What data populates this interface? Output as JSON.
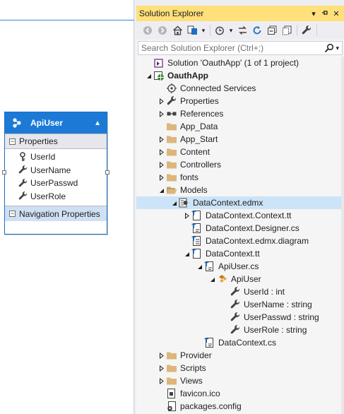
{
  "designer": {
    "entity": {
      "name": "ApiUser",
      "properties_header": "Properties",
      "properties": [
        "UserId",
        "UserName",
        "UserPasswd",
        "UserRole"
      ],
      "navigation_header": "Navigation Properties"
    }
  },
  "solution_explorer": {
    "title": "Solution Explorer",
    "search_placeholder": "Search Solution Explorer (Ctrl+;)",
    "tree": [
      {
        "label": "Solution 'OauthApp' (1 of 1 project)",
        "icon": "solution-icon",
        "level": 0,
        "expander": "none"
      },
      {
        "label": "OauthApp",
        "icon": "web-project-icon",
        "level": 0,
        "expander": "expanded",
        "bold": true
      },
      {
        "label": "Connected Services",
        "icon": "connected-services-icon",
        "level": 1,
        "expander": "none"
      },
      {
        "label": "Properties",
        "icon": "wrench-icon",
        "level": 1,
        "expander": "collapsed"
      },
      {
        "label": "References",
        "icon": "references-icon",
        "level": 1,
        "expander": "collapsed"
      },
      {
        "label": "App_Data",
        "icon": "folder-icon",
        "level": 1,
        "expander": "none"
      },
      {
        "label": "App_Start",
        "icon": "folder-icon",
        "level": 1,
        "expander": "collapsed"
      },
      {
        "label": "Content",
        "icon": "folder-icon",
        "level": 1,
        "expander": "collapsed"
      },
      {
        "label": "Controllers",
        "icon": "folder-icon",
        "level": 1,
        "expander": "collapsed"
      },
      {
        "label": "fonts",
        "icon": "folder-icon",
        "level": 1,
        "expander": "collapsed"
      },
      {
        "label": "Models",
        "icon": "folder-open-icon",
        "level": 1,
        "expander": "expanded"
      },
      {
        "label": "DataContext.edmx",
        "icon": "edmx-icon",
        "level": 2,
        "expander": "expanded",
        "selected": true
      },
      {
        "label": "DataContext.Context.tt",
        "icon": "tt-file-icon",
        "level": 3,
        "expander": "collapsed"
      },
      {
        "label": "DataContext.Designer.cs",
        "icon": "cs-file-icon",
        "level": 3,
        "expander": "none"
      },
      {
        "label": "DataContext.edmx.diagram",
        "icon": "diagram-file-icon",
        "level": 3,
        "expander": "none"
      },
      {
        "label": "DataContext.tt",
        "icon": "tt-file-icon",
        "level": 3,
        "expander": "expanded"
      },
      {
        "label": "ApiUser.cs",
        "icon": "cs-file-icon",
        "level": 4,
        "expander": "expanded"
      },
      {
        "label": "ApiUser",
        "icon": "class-icon",
        "level": 5,
        "expander": "expanded"
      },
      {
        "label": "UserId : int",
        "icon": "wrench-icon",
        "level": 6,
        "expander": "none"
      },
      {
        "label": "UserName : string",
        "icon": "wrench-icon",
        "level": 6,
        "expander": "none"
      },
      {
        "label": "UserPasswd : string",
        "icon": "wrench-icon",
        "level": 6,
        "expander": "none"
      },
      {
        "label": "UserRole : string",
        "icon": "wrench-icon",
        "level": 6,
        "expander": "none"
      },
      {
        "label": "DataContext.cs",
        "icon": "cs-file-icon",
        "level": 4,
        "expander": "none"
      },
      {
        "label": "Provider",
        "icon": "folder-icon",
        "level": 1,
        "expander": "collapsed"
      },
      {
        "label": "Scripts",
        "icon": "folder-icon",
        "level": 1,
        "expander": "collapsed"
      },
      {
        "label": "Views",
        "icon": "folder-icon",
        "level": 1,
        "expander": "collapsed"
      },
      {
        "label": "favicon.ico",
        "icon": "ico-file-icon",
        "level": 1,
        "expander": "none"
      },
      {
        "label": "packages.config",
        "icon": "config-file-icon",
        "level": 1,
        "expander": "none"
      }
    ]
  },
  "colors": {
    "title_bar": "#ffe07a",
    "entity_header": "#1c7ad6",
    "selection": "#cce4f7",
    "folder": "#dcb67a"
  }
}
